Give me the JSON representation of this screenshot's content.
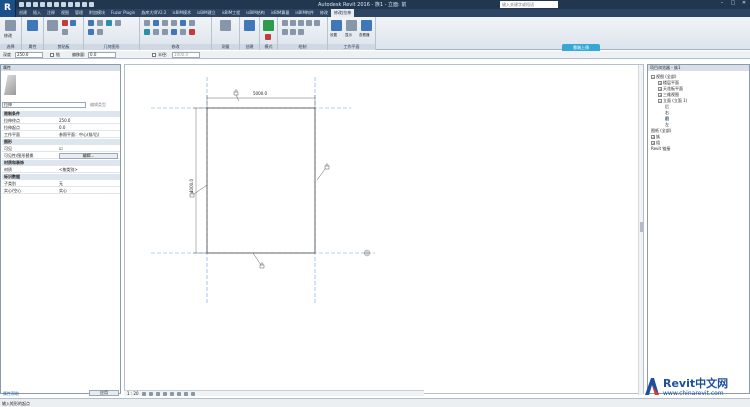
{
  "window": {
    "title": "Autodesk Revit 2016 - 族1 - 立面: 前",
    "search_placeholder": "键入关键字或短语"
  },
  "tabs": [
    "创建",
    "插入",
    "注释",
    "视图",
    "管理",
    "附加模块",
    "Fuzor Plugin",
    "族库大师V2.2",
    "isBIM模术",
    "isBIM建立",
    "isBIM工程",
    "isBIM结构",
    "isBIM算量",
    "isBIM构件",
    "修改",
    "修改|拉伸"
  ],
  "active_tab": "修改|拉伸",
  "ribbon": {
    "panels": [
      {
        "label": "选择"
      },
      {
        "label": "属性"
      },
      {
        "label": "剪贴板"
      },
      {
        "label": "几何图形"
      },
      {
        "label": "修改"
      },
      {
        "label": "测量"
      },
      {
        "label": "创建"
      },
      {
        "label": "模式"
      },
      {
        "label": "绘制"
      },
      {
        "label": "工作平面"
      }
    ],
    "modify_label": "修改",
    "workplane_items": [
      "设置",
      "显示",
      "查看器"
    ],
    "cloud_button": "雲端上傳"
  },
  "options_bar": {
    "depth_label": "深度",
    "depth_value": "250.0",
    "chain_label": "链",
    "offset_label": "偏移量:",
    "offset_value": "0.0",
    "radius_label": "半径:",
    "radius_value": "1000.0"
  },
  "properties": {
    "title": "属性",
    "type_selector": "拉伸",
    "edit_type": "编辑类型",
    "rows": [
      {
        "key": "限制条件",
        "value": "",
        "group": true
      },
      {
        "key": "拉伸终点",
        "value": "250.0"
      },
      {
        "key": "拉伸起点",
        "value": "0.0"
      },
      {
        "key": "工作平面",
        "value": "参照平面：中心(前/后)"
      },
      {
        "key": "图形",
        "value": "",
        "group": true
      },
      {
        "key": "可见",
        "value": "☑"
      },
      {
        "key": "可见性/图形替换",
        "value": "编辑...",
        "button": true
      },
      {
        "key": "材质和装饰",
        "value": "",
        "group": true
      },
      {
        "key": "材质",
        "value": "<按类别>"
      },
      {
        "key": "标识数据",
        "value": "",
        "group": true
      },
      {
        "key": "子类别",
        "value": "无"
      },
      {
        "key": "实心/空心",
        "value": "实心"
      }
    ],
    "help_link": "属性帮助",
    "apply_button": "应用"
  },
  "canvas": {
    "dim_horizontal": "5000.0",
    "dim_vertical": "4000.0",
    "lock_icon": "lock-icon"
  },
  "view_control": {
    "scale": "1 : 20"
  },
  "project_browser": {
    "title": "项目浏览器 - 族1",
    "items": [
      {
        "label": "视图 (全部)",
        "indent": 0,
        "exp": "−"
      },
      {
        "label": "楼层平面",
        "indent": 1,
        "exp": "+"
      },
      {
        "label": "天花板平面",
        "indent": 1,
        "exp": "+"
      },
      {
        "label": "三维视图",
        "indent": 1,
        "exp": "+"
      },
      {
        "label": "立面 (立面 1)",
        "indent": 1,
        "exp": "−"
      },
      {
        "label": "后",
        "indent": 2,
        "exp": ""
      },
      {
        "label": "右",
        "indent": 2,
        "exp": ""
      },
      {
        "label": "前",
        "indent": 2,
        "exp": "",
        "selected": true
      },
      {
        "label": "左",
        "indent": 2,
        "exp": ""
      },
      {
        "label": "图纸 (全部)",
        "indent": 0,
        "exp": ""
      },
      {
        "label": "族",
        "indent": 0,
        "exp": "+"
      },
      {
        "label": "组",
        "indent": 0,
        "exp": "+"
      },
      {
        "label": "Revit 链接",
        "indent": 0,
        "exp": ""
      }
    ]
  },
  "status": {
    "text": "输入矩形的起点"
  },
  "watermark": {
    "title": "Revit中文网",
    "url": "www.chinarevit.com"
  }
}
